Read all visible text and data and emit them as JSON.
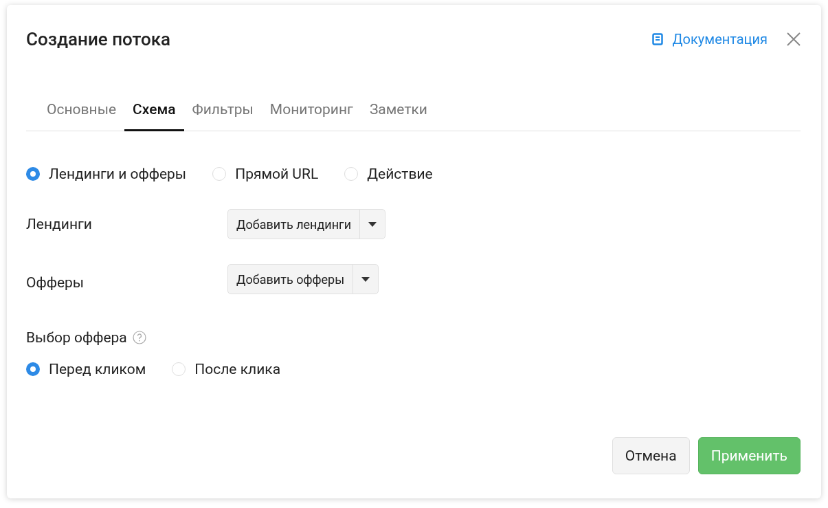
{
  "dialog": {
    "title": "Создание потока",
    "doc_link": "Документация"
  },
  "tabs": [
    {
      "label": "Основные",
      "selected": false
    },
    {
      "label": "Схема",
      "selected": true
    },
    {
      "label": "Фильтры",
      "selected": false
    },
    {
      "label": "Мониторинг",
      "selected": false
    },
    {
      "label": "Заметки",
      "selected": false
    }
  ],
  "schema_type": [
    {
      "label": "Лендинги и офферы",
      "selected": true
    },
    {
      "label": "Прямой URL",
      "selected": false
    },
    {
      "label": "Действие",
      "selected": false
    }
  ],
  "fields": [
    {
      "label": "Лендинги",
      "button": "Добавить лендинги"
    },
    {
      "label": "Офферы",
      "button": "Добавить офферы"
    }
  ],
  "offer_choice": {
    "label": "Выбор оффера",
    "options": [
      {
        "label": "Перед кликом",
        "selected": true
      },
      {
        "label": "После клика",
        "selected": false
      }
    ]
  },
  "buttons": [
    {
      "label": "Отмена",
      "kind": "secondary"
    },
    {
      "label": "Применить",
      "kind": "primary"
    }
  ]
}
